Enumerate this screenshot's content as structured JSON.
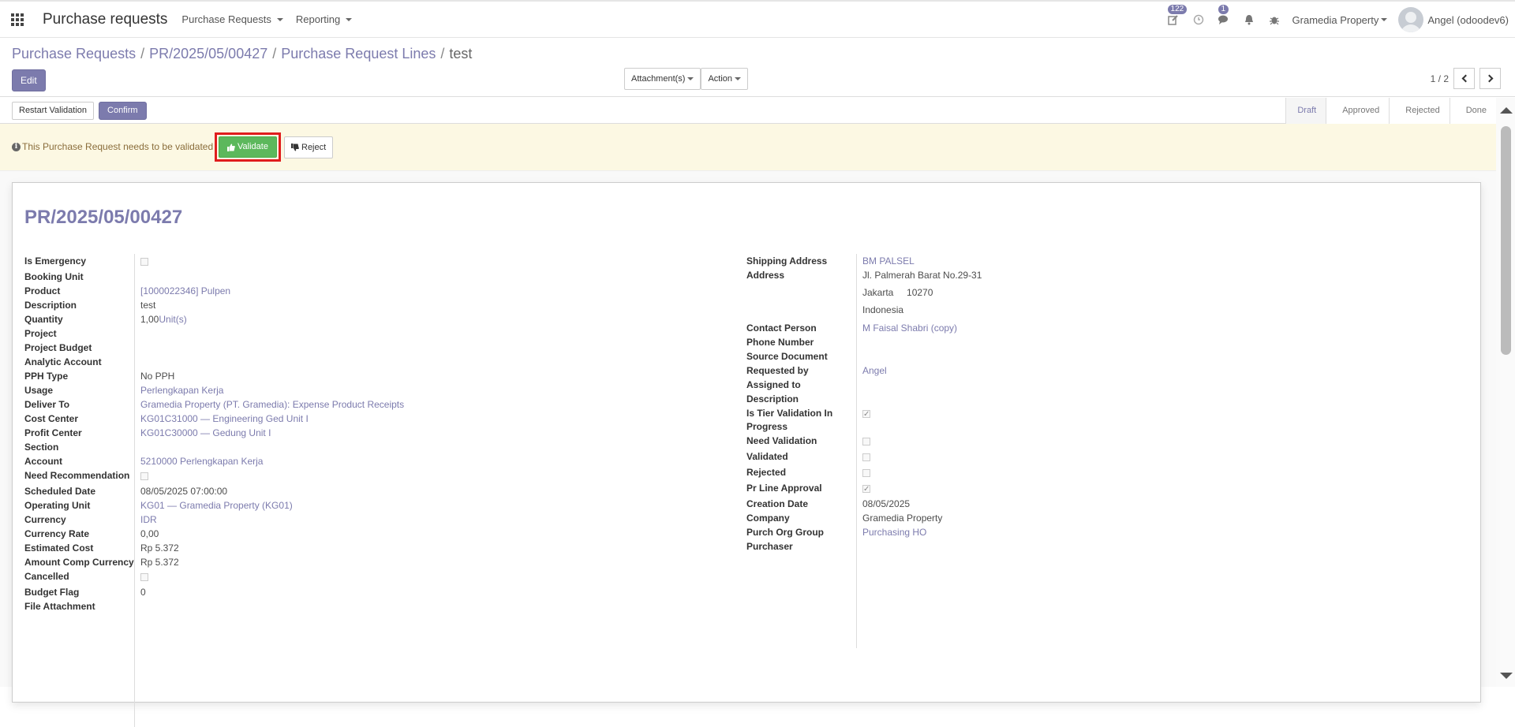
{
  "navbar": {
    "app_title": "Purchase requests",
    "menus": [
      "Purchase Requests",
      "Reporting"
    ],
    "activity_count": "122",
    "messages_count": "1",
    "company": "Gramedia Property",
    "user": "Angel (odoodev6)"
  },
  "breadcrumb": [
    "Purchase Requests",
    "PR/2025/05/00427",
    "Purchase Request Lines",
    "test"
  ],
  "control": {
    "edit_label": "Edit",
    "attachments_label": "Attachment(s)",
    "action_label": "Action",
    "pager": "1 / 2"
  },
  "statusbar": {
    "restart_label": "Restart Validation",
    "confirm_label": "Confirm",
    "stages": [
      "Draft",
      "Approved",
      "Rejected",
      "Done"
    ],
    "current_stage": "Draft"
  },
  "alert": {
    "message": "This Purchase Request needs to be validated",
    "validate_label": "Validate",
    "reject_label": "Reject"
  },
  "record": {
    "title": "PR/2025/05/00427",
    "left_fields": [
      {
        "label": "Is Emergency",
        "type": "checkbox",
        "checked": false
      },
      {
        "label": "Booking Unit",
        "type": "text",
        "value": ""
      },
      {
        "label": "Product",
        "type": "link",
        "value": "[1000022346] Pulpen"
      },
      {
        "label": "Description",
        "type": "text",
        "value": "test"
      },
      {
        "label": "Quantity",
        "type": "qty",
        "value": "1,00",
        "unit": "Unit(s)"
      },
      {
        "label": "Project",
        "type": "text",
        "value": ""
      },
      {
        "label": "Project Budget",
        "type": "text",
        "value": ""
      },
      {
        "label": "Analytic Account",
        "type": "text",
        "value": ""
      },
      {
        "label": "PPH Type",
        "type": "text",
        "value": "No PPH"
      },
      {
        "label": "Usage",
        "type": "link",
        "value": "Perlengkapan Kerja"
      },
      {
        "label": "Deliver To",
        "type": "link",
        "value": "Gramedia Property (PT. Gramedia): Expense Product Receipts"
      },
      {
        "label": "Cost Center",
        "type": "link",
        "value": "KG01C31000 — Engineering Ged Unit I"
      },
      {
        "label": "Profit Center",
        "type": "link",
        "value": "KG01C30000 — Gedung Unit I"
      },
      {
        "label": "Section",
        "type": "text",
        "value": ""
      },
      {
        "label": "Account",
        "type": "link",
        "value": "5210000 Perlengkapan Kerja"
      },
      {
        "label": "Need Recommendation",
        "type": "checkbox",
        "checked": false
      },
      {
        "label": "Scheduled Date",
        "type": "text",
        "value": "08/05/2025 07:00:00"
      },
      {
        "label": "Operating Unit",
        "type": "link",
        "value": "KG01 — Gramedia Property (KG01)"
      },
      {
        "label": "Currency",
        "type": "link",
        "value": "IDR"
      },
      {
        "label": "Currency Rate",
        "type": "text",
        "value": "0,00"
      },
      {
        "label": "Estimated Cost",
        "type": "text",
        "value": "Rp 5.372"
      },
      {
        "label": "Amount Comp Currency",
        "type": "text",
        "value": "Rp 5.372"
      },
      {
        "label": "Cancelled",
        "type": "checkbox",
        "checked": false
      },
      {
        "label": "Budget Flag",
        "type": "text",
        "value": "0"
      },
      {
        "label": "File Attachment",
        "type": "text",
        "value": ""
      }
    ],
    "right_fields": [
      {
        "label": "Shipping Address",
        "type": "link",
        "value": "BM PALSEL"
      },
      {
        "label": "Address",
        "type": "multiline",
        "lines": [
          "Jl. Palmerah Barat No.29-31",
          "Jakarta     10270",
          "Indonesia"
        ]
      },
      {
        "label": "Contact Person",
        "type": "link",
        "value": "M Faisal Shabri (copy)"
      },
      {
        "label": "Phone Number",
        "type": "text",
        "value": ""
      },
      {
        "label": "Source Document",
        "type": "text",
        "value": ""
      },
      {
        "label": "Requested by",
        "type": "link",
        "value": "Angel"
      },
      {
        "label": "Assigned to",
        "type": "text",
        "value": ""
      },
      {
        "label": "Description",
        "type": "text",
        "value": ""
      },
      {
        "label": "Is Tier Validation In Progress",
        "type": "checkbox",
        "checked": true
      },
      {
        "label": "Need Validation",
        "type": "checkbox",
        "checked": false
      },
      {
        "label": "Validated",
        "type": "checkbox",
        "checked": false
      },
      {
        "label": "Rejected",
        "type": "checkbox",
        "checked": false
      },
      {
        "label": "Pr Line Approval",
        "type": "checkbox",
        "checked": true
      },
      {
        "label": "Creation Date",
        "type": "text",
        "value": "08/05/2025"
      },
      {
        "label": "Company",
        "type": "text",
        "value": "Gramedia Property"
      },
      {
        "label": "Purch Org Group",
        "type": "link",
        "value": "Purchasing HO"
      },
      {
        "label": "Purchaser",
        "type": "text",
        "value": ""
      }
    ]
  }
}
